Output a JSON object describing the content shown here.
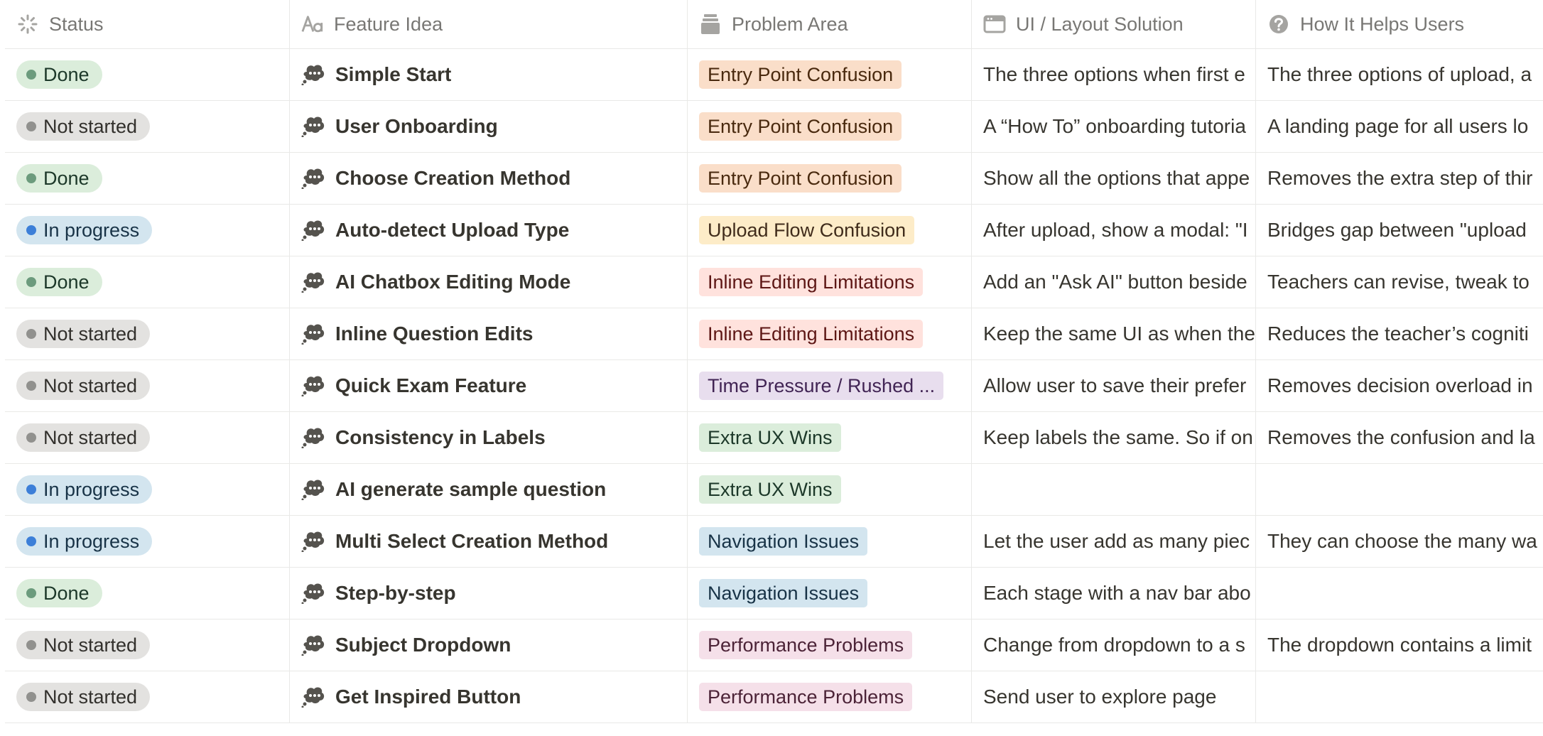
{
  "headers": [
    {
      "label": "Status",
      "icon": "status-spinner-icon"
    },
    {
      "label": "Feature Idea",
      "icon": "text-aa-icon"
    },
    {
      "label": "Problem Area",
      "icon": "stack-icon"
    },
    {
      "label": "UI / Layout Solution",
      "icon": "window-icon"
    },
    {
      "label": "How It Helps Users",
      "icon": "question-circle-icon"
    }
  ],
  "colors": {
    "done": "#dbeddb",
    "in_progress": "#d3e5ef",
    "not_started": "#e3e2e0"
  },
  "rows": [
    {
      "status": "Done",
      "status_kind": "done",
      "feature": "Simple Start",
      "problem": "Entry Point Confusion",
      "problem_color": "orange",
      "solution": "The three options when first e",
      "helps": "The three options of upload, a"
    },
    {
      "status": "Not started",
      "status_kind": "notstarted",
      "feature": "User Onboarding",
      "problem": "Entry Point Confusion",
      "problem_color": "orange",
      "solution": "A “How To” onboarding tutoria",
      "helps": "A landing page for all users lo"
    },
    {
      "status": "Done",
      "status_kind": "done",
      "feature": "Choose Creation Method",
      "problem": "Entry Point Confusion",
      "problem_color": "orange",
      "solution": "Show all the options that appe",
      "helps": "Removes the extra step of thir"
    },
    {
      "status": "In progress",
      "status_kind": "progress",
      "feature": "Auto-detect Upload Type",
      "problem": "Upload Flow Confusion",
      "problem_color": "yellow",
      "solution": "After upload, show a modal: \"I",
      "helps": "Bridges gap between \"upload"
    },
    {
      "status": "Done",
      "status_kind": "done",
      "feature": "AI Chatbox Editing Mode",
      "problem": "Inline Editing Limitations",
      "problem_color": "red",
      "solution": "Add an \"Ask AI\" button beside",
      "helps": "Teachers can revise, tweak to"
    },
    {
      "status": "Not started",
      "status_kind": "notstarted",
      "feature": "Inline Question Edits",
      "problem": "Inline Editing Limitations",
      "problem_color": "red",
      "solution": "Keep the same UI as when the",
      "helps": "Reduces the teacher’s cogniti"
    },
    {
      "status": "Not started",
      "status_kind": "notstarted",
      "feature": "Quick Exam Feature",
      "problem": "Time Pressure / Rushed ...",
      "problem_color": "purple",
      "solution": "Allow user to save their prefer",
      "helps": "Removes decision overload in"
    },
    {
      "status": "Not started",
      "status_kind": "notstarted",
      "feature": "Consistency in Labels",
      "problem": "Extra UX Wins",
      "problem_color": "green",
      "solution": "Keep labels the same. So if on",
      "helps": "Removes the confusion and la"
    },
    {
      "status": "In progress",
      "status_kind": "progress",
      "feature": "AI generate sample question",
      "problem": "Extra UX Wins",
      "problem_color": "green",
      "solution": "",
      "helps": ""
    },
    {
      "status": "In progress",
      "status_kind": "progress",
      "feature": "Multi Select Creation Method",
      "problem": "Navigation Issues",
      "problem_color": "blue",
      "solution": "Let the user add as many piec",
      "helps": "They can choose the many wa"
    },
    {
      "status": "Done",
      "status_kind": "done",
      "feature": "Step-by-step",
      "problem": "Navigation Issues",
      "problem_color": "blue",
      "solution": "Each stage with a nav bar abo",
      "helps": ""
    },
    {
      "status": "Not started",
      "status_kind": "notstarted",
      "feature": "Subject Dropdown",
      "problem": "Performance Problems",
      "problem_color": "pink",
      "solution": "Change from dropdown to a s",
      "helps": "The dropdown contains a limit"
    },
    {
      "status": "Not started",
      "status_kind": "notstarted",
      "feature": "Get Inspired Button",
      "problem": "Performance Problems",
      "problem_color": "pink",
      "solution": "Send user to explore page",
      "helps": ""
    }
  ]
}
